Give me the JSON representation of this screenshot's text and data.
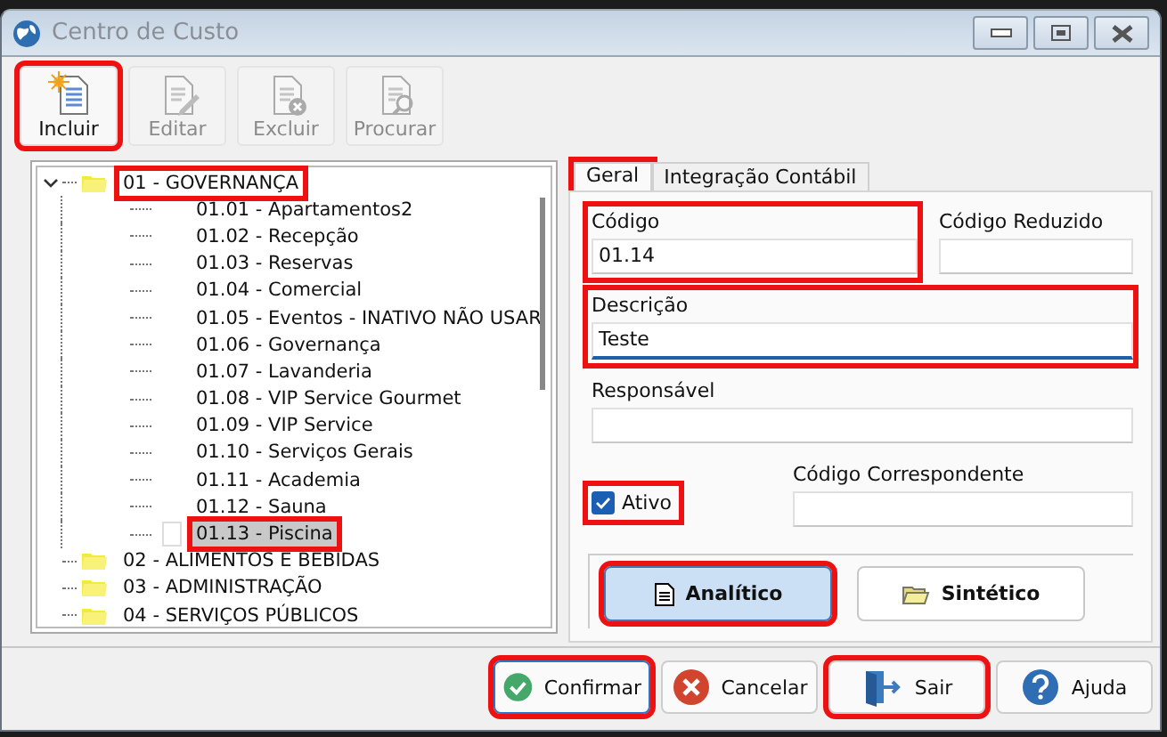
{
  "window": {
    "title": "Centro de Custo"
  },
  "toolbar": [
    {
      "label": "Incluir",
      "kind": "new",
      "disabled": false,
      "highlighted": true
    },
    {
      "label": "Editar",
      "kind": "edit",
      "disabled": true,
      "highlighted": false
    },
    {
      "label": "Excluir",
      "kind": "delete",
      "disabled": true,
      "highlighted": false
    },
    {
      "label": "Procurar",
      "kind": "find",
      "disabled": true,
      "highlighted": false
    }
  ],
  "tree": {
    "items": [
      {
        "label": "01 - GOVERNANÇA",
        "expanded": true,
        "selected": false,
        "highlighted": true,
        "children": [
          {
            "label": "01.01 - Apartamentos2",
            "selected": false,
            "highlighted": false
          },
          {
            "label": "01.02 - Recepção",
            "selected": false,
            "highlighted": false
          },
          {
            "label": "01.03 - Reservas",
            "selected": false,
            "highlighted": false
          },
          {
            "label": "01.04 - Comercial",
            "selected": false,
            "highlighted": false
          },
          {
            "label": "01.05 - Eventos - INATIVO NÃO USAR",
            "selected": false,
            "highlighted": false
          },
          {
            "label": "01.06 - Governança",
            "selected": false,
            "highlighted": false
          },
          {
            "label": "01.07 - Lavanderia",
            "selected": false,
            "highlighted": false
          },
          {
            "label": "01.08 - VIP Service Gourmet",
            "selected": false,
            "highlighted": false
          },
          {
            "label": "01.09 - VIP Service",
            "selected": false,
            "highlighted": false
          },
          {
            "label": "01.10 - Serviços Gerais",
            "selected": false,
            "highlighted": false
          },
          {
            "label": "01.11 - Academia",
            "selected": false,
            "highlighted": false
          },
          {
            "label": "01.12 - Sauna",
            "selected": false,
            "highlighted": false
          },
          {
            "label": "01.13 - Piscina",
            "selected": true,
            "highlighted": true
          }
        ]
      },
      {
        "label": "02 - ALIMENTOS E BEBIDAS",
        "expanded": false,
        "selected": false,
        "highlighted": false
      },
      {
        "label": "03 - ADMINISTRAÇÃO",
        "expanded": false,
        "selected": false,
        "highlighted": false
      },
      {
        "label": "04 - SERVIÇOS PÚBLICOS",
        "expanded": false,
        "selected": false,
        "highlighted": false
      }
    ]
  },
  "tabs": [
    {
      "label": "Geral",
      "selected": true,
      "highlighted": true
    },
    {
      "label": "Integração Contábil",
      "selected": false,
      "highlighted": false
    }
  ],
  "form": {
    "codigo": {
      "label": "Código",
      "value": "01.14",
      "focused": false,
      "highlighted": true
    },
    "codigo_reduzido": {
      "label": "Código Reduzido",
      "focused": false,
      "highlighted": false
    },
    "descricao": {
      "label": "Descrição",
      "value": "Teste",
      "focused": true,
      "highlighted": true
    },
    "responsavel": {
      "label": "Responsável",
      "focused": false,
      "highlighted": false
    },
    "ativo": {
      "label": "Ativo",
      "checked": true,
      "highlighted": true
    },
    "codigo_correspondente": {
      "label": "Código Correspondente",
      "focused": false,
      "highlighted": false
    },
    "type_buttons": [
      {
        "label": "Analítico",
        "kind": "document",
        "selected": true,
        "highlighted": true
      },
      {
        "label": "Sintético",
        "kind": "folder",
        "selected": false,
        "highlighted": false
      }
    ]
  },
  "buttons": [
    {
      "label": "Confirmar",
      "kind": "confirm",
      "default": true,
      "highlighted": true
    },
    {
      "label": "Cancelar",
      "kind": "cancel",
      "default": false,
      "highlighted": false
    },
    {
      "label": "Sair",
      "kind": "exit",
      "default": false,
      "highlighted": true
    },
    {
      "label": "Ajuda",
      "kind": "help",
      "default": false,
      "highlighted": false
    }
  ]
}
